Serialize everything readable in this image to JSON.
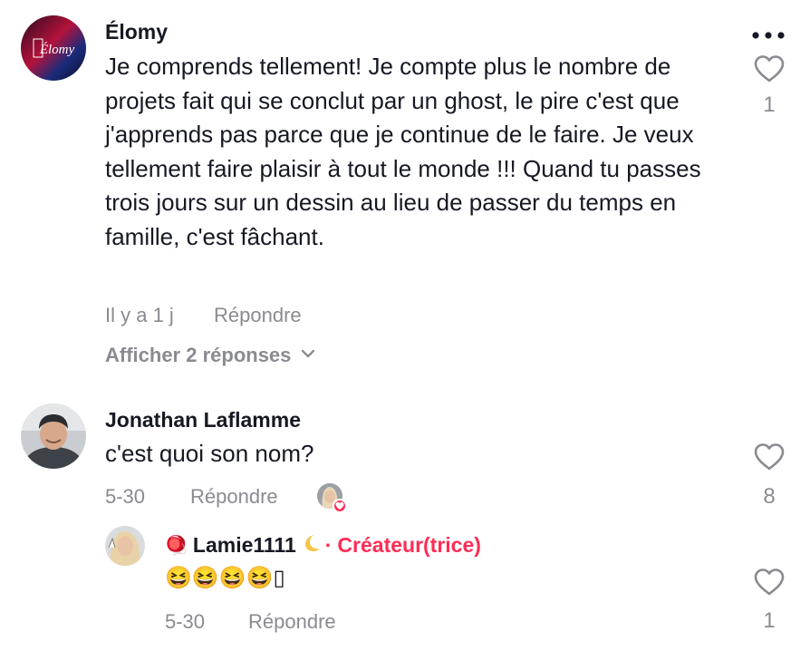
{
  "comments": [
    {
      "username": "Élomy",
      "avatar_text": "Élomy",
      "text": "Je comprends tellement! Je compte plus le nombre de projets fait qui se conclut par un ghost, le pire c'est que j'apprends pas parce que je continue de le faire. Je veux tellement faire plaisir à tout le monde !!! Quand tu passes trois jours sur un dessin au lieu de passer du temps en famille, c'est fâchant.",
      "time": "Il y a 1 j",
      "reply_label": "Répondre",
      "likes": "1",
      "show_replies_label": "Afficher 2 réponses"
    },
    {
      "username": "Jonathan Laflamme",
      "text": "c'est quoi son nom?",
      "time": "5-30",
      "reply_label": "Répondre",
      "likes": "8",
      "replies": [
        {
          "username": "Lamie1111",
          "badge": "Créateur(trice)",
          "separator": "·",
          "text": "😆😆😆😆▯",
          "time": "5-30",
          "reply_label": "Répondre",
          "likes": "1"
        }
      ]
    }
  ],
  "menu_icon": "more-horizontal-icon",
  "colors": {
    "accent": "#fe2c55",
    "muted": "#8a8b91",
    "text": "#161823"
  }
}
